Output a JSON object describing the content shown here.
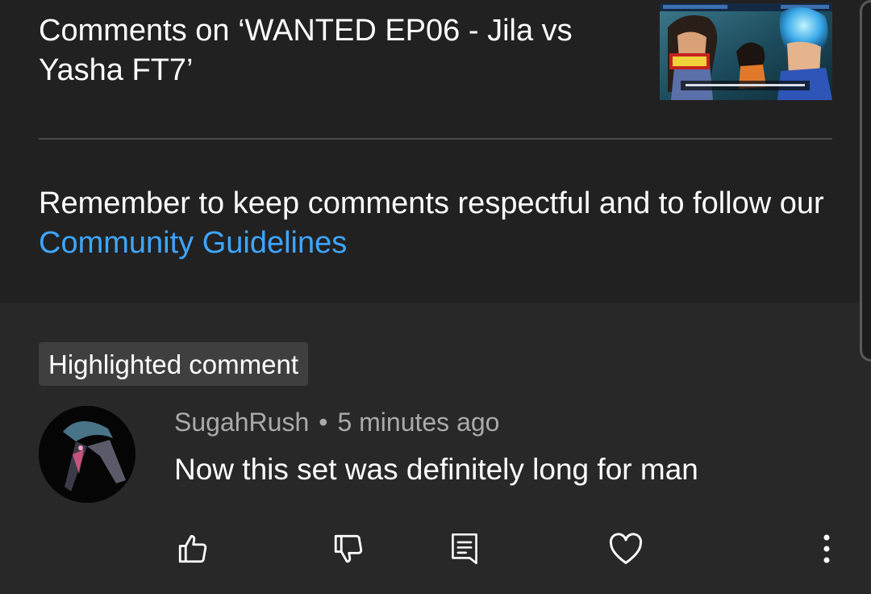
{
  "header": {
    "title": "Comments on ‘WANTED EP06 - Jila vs Yasha FT7’"
  },
  "notice": {
    "text": "Remember to keep comments respectful and to follow our ",
    "link_label": "Community Guidelines"
  },
  "highlighted_comment": {
    "badge_label": "Highlighted comment",
    "author": "SugahRush",
    "separator": "•",
    "time": "5 minutes ago",
    "text": "Now this set was definitely long for man"
  },
  "actions": {
    "icons": [
      "thumbs-up-icon",
      "thumbs-down-icon",
      "reply-icon",
      "heart-icon",
      "more-vert-icon"
    ]
  },
  "colors": {
    "background": "#282828",
    "header_background": "#212121",
    "link": "#3ea6ff",
    "secondary_text": "#aaaaaa",
    "badge": "#3f3f3f"
  }
}
